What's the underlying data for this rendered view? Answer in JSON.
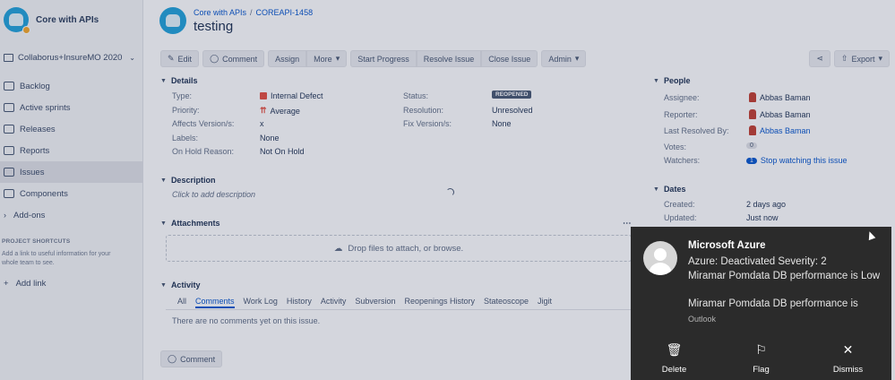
{
  "sidebar": {
    "project_name": "Core with APIs",
    "board": "Collaborus+InsureMO 2020",
    "items": [
      {
        "label": "Backlog"
      },
      {
        "label": "Active sprints"
      },
      {
        "label": "Releases"
      },
      {
        "label": "Reports"
      },
      {
        "label": "Issues"
      },
      {
        "label": "Components"
      }
    ],
    "addons": "Add-ons",
    "shortcuts_title": "PROJECT SHORTCUTS",
    "shortcuts_help": "Add a link to useful information for your whole team to see.",
    "add_link": "Add link"
  },
  "header": {
    "breadcrumb_project": "Core with APIs",
    "breadcrumb_sep": "/",
    "breadcrumb_key": "COREAPI-1458",
    "title": "testing"
  },
  "toolbar": {
    "edit": "Edit",
    "comment": "Comment",
    "assign": "Assign",
    "more": "More",
    "start_progress": "Start Progress",
    "resolve": "Resolve Issue",
    "close": "Close Issue",
    "admin": "Admin",
    "export": "Export"
  },
  "details": {
    "title": "Details",
    "type_label": "Type:",
    "type_value": "Internal Defect",
    "priority_label": "Priority:",
    "priority_value": "Average",
    "affects_label": "Affects Version/s:",
    "affects_value": "x",
    "labels_label": "Labels:",
    "labels_value": "None",
    "onhold_label": "On Hold Reason:",
    "onhold_value": "Not On Hold",
    "status_label": "Status:",
    "status_value": "REOPENED",
    "resolution_label": "Resolution:",
    "resolution_value": "Unresolved",
    "fix_label": "Fix Version/s:",
    "fix_value": "None"
  },
  "description": {
    "title": "Description",
    "placeholder": "Click to add description"
  },
  "attachments": {
    "title": "Attachments",
    "drop_text": "Drop files to attach, or browse."
  },
  "activity": {
    "title": "Activity",
    "tabs": [
      "All",
      "Comments",
      "Work Log",
      "History",
      "Activity",
      "Subversion",
      "Reopenings History",
      "Stateoscope",
      "Jigit"
    ],
    "empty": "There are no comments yet on this issue.",
    "comment_button": "Comment"
  },
  "people": {
    "title": "People",
    "assignee_label": "Assignee:",
    "assignee_value": "Abbas Baman",
    "reporter_label": "Reporter:",
    "reporter_value": "Abbas Baman",
    "resolved_label": "Last Resolved By:",
    "resolved_value": "Abbas Baman",
    "votes_label": "Votes:",
    "votes_value": "0",
    "watchers_label": "Watchers:",
    "watchers_count": "1",
    "watchers_link": "Stop watching this issue"
  },
  "dates": {
    "title": "Dates",
    "created_label": "Created:",
    "created_value": "2 days ago",
    "updated_label": "Updated:",
    "updated_value": "Just now"
  },
  "toast": {
    "title": "Microsoft Azure",
    "line1": "Azure: Deactivated Severity: 2",
    "line2": "Miramar Pomdata DB performance is Low",
    "line3": "Miramar Pomdata DB performance is",
    "source": "Outlook",
    "delete": "Delete",
    "flag": "Flag",
    "dismiss": "Dismiss"
  }
}
